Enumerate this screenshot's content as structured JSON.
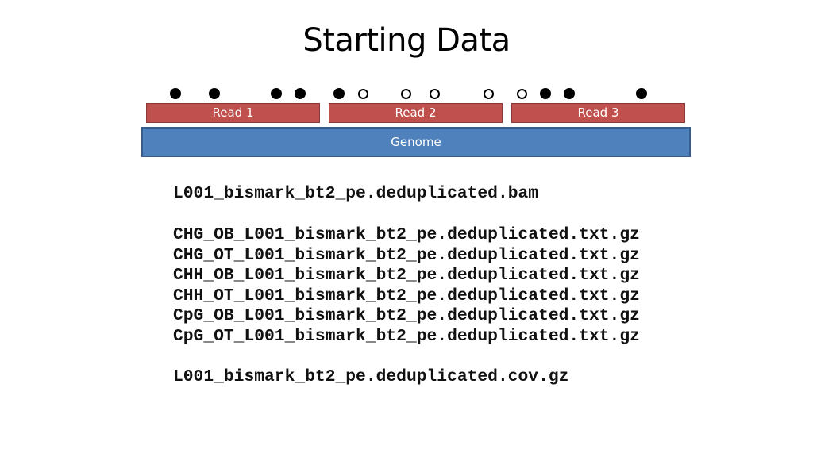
{
  "title": "Starting Data",
  "methylation_sites": [
    {
      "state": "methylated"
    },
    {
      "state": "methylated"
    },
    {
      "state": "methylated"
    },
    {
      "state": "methylated"
    },
    {
      "state": "methylated"
    },
    {
      "state": "unmethylated"
    },
    {
      "state": "unmethylated"
    },
    {
      "state": "unmethylated"
    },
    {
      "state": "unmethylated"
    },
    {
      "state": "unmethylated"
    },
    {
      "state": "methylated"
    },
    {
      "state": "methylated"
    },
    {
      "state": "methylated"
    }
  ],
  "reads": [
    {
      "label": "Read 1"
    },
    {
      "label": "Read 2"
    },
    {
      "label": "Read 3"
    }
  ],
  "genome": {
    "label": "Genome"
  },
  "files": {
    "bam": "L001_bismark_bt2_pe.deduplicated.bam",
    "context_files": [
      "CHG_OB_L001_bismark_bt2_pe.deduplicated.txt.gz",
      "CHG_OT_L001_bismark_bt2_pe.deduplicated.txt.gz",
      "CHH_OB_L001_bismark_bt2_pe.deduplicated.txt.gz",
      "CHH_OT_L001_bismark_bt2_pe.deduplicated.txt.gz",
      "CpG_OB_L001_bismark_bt2_pe.deduplicated.txt.gz",
      "CpG_OT_L001_bismark_bt2_pe.deduplicated.txt.gz"
    ],
    "coverage": "L001_bismark_bt2_pe.deduplicated.cov.gz"
  },
  "colors": {
    "read_fill": "#C0504D",
    "genome_fill": "#4F81BD"
  }
}
